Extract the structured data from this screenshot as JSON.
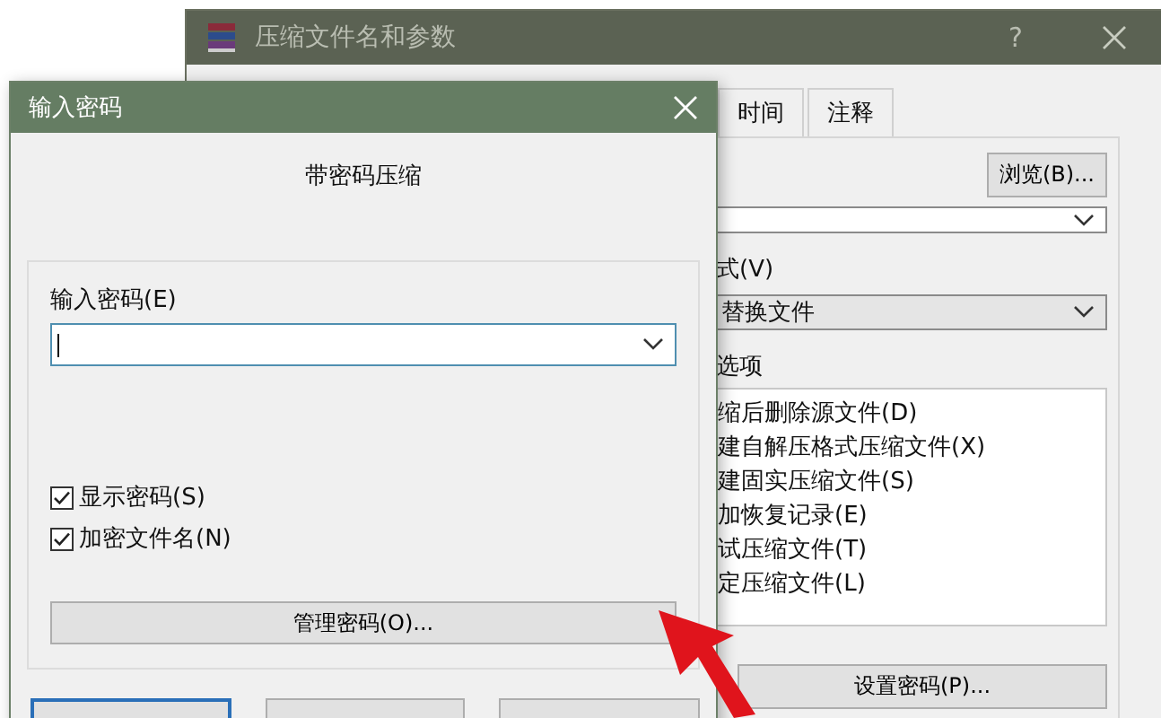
{
  "back_window": {
    "title": "压缩文件名和参数",
    "help": "?",
    "tabs": [
      {
        "label": "时间",
        "selected": false
      },
      {
        "label": "注释",
        "selected": false
      }
    ],
    "browse_button": "浏览(B)...",
    "update_mode": {
      "label": "式(V)",
      "value": "替换文件"
    },
    "options": {
      "label": "选项",
      "items": [
        "缩后删除源文件(D)",
        "建自解压格式压缩文件(X)",
        "建固实压缩文件(S)",
        "加恢复记录(E)",
        "试压缩文件(T)",
        "定压缩文件(L)"
      ]
    },
    "set_password_button": "设置密码(P)..."
  },
  "password_dialog": {
    "title": "输入密码",
    "heading": "带密码压缩",
    "password_field": {
      "label": "输入密码(E)"
    },
    "checkboxes": [
      {
        "label": "显示密码(S)",
        "checked": true
      },
      {
        "label": "加密文件名(N)",
        "checked": true
      }
    ],
    "manage_button": "管理密码(O)...",
    "footer_buttons": [
      {
        "default": true
      },
      {
        "default": false
      },
      {
        "default": false
      }
    ]
  }
}
